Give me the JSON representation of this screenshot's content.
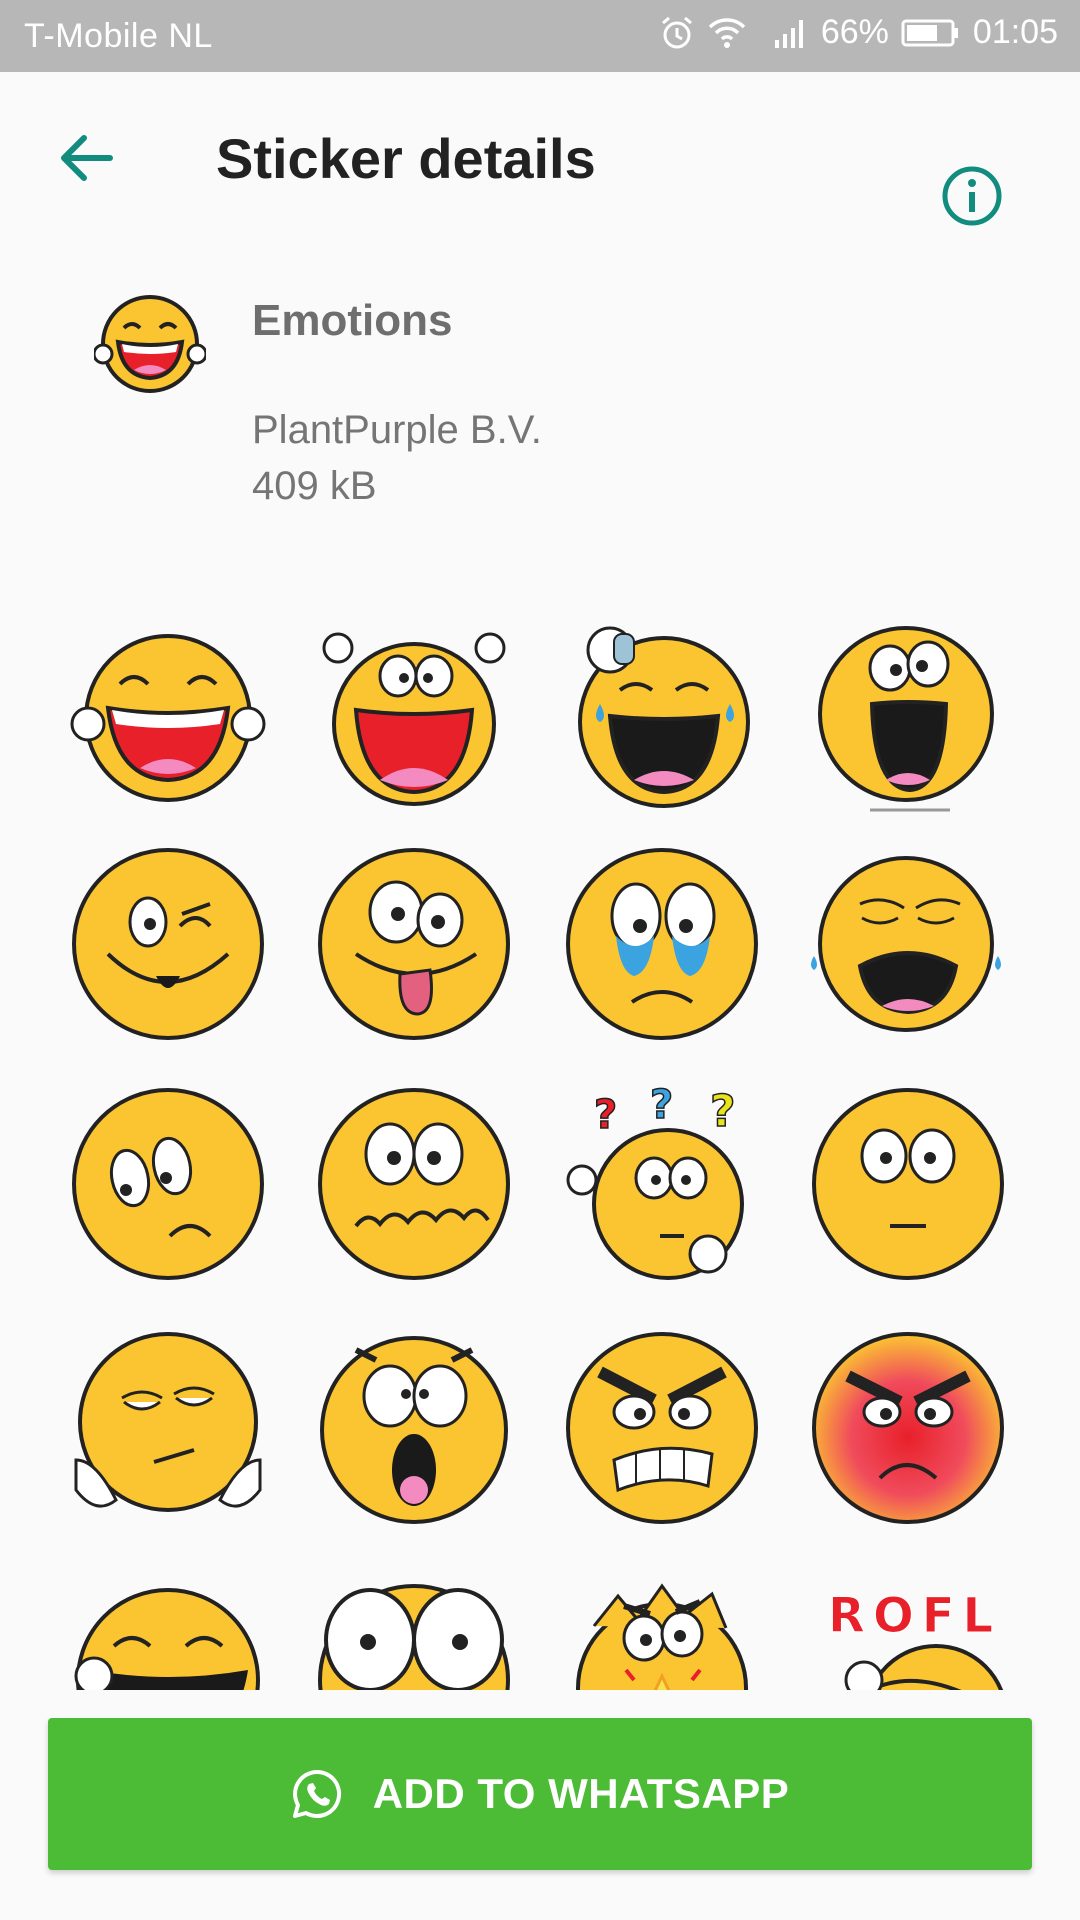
{
  "status_bar": {
    "carrier": "T-Mobile  NL",
    "battery_percent": "66%",
    "time": "01:05",
    "icons": [
      "alarm-icon",
      "wifi-icon",
      "signal-icon",
      "battery-icon"
    ]
  },
  "app_bar": {
    "back_icon": "arrow-left-icon",
    "title": "Sticker details",
    "info_icon": "info-icon",
    "accent_color": "#128c7e"
  },
  "pack": {
    "icon": "laughing-face-sticker",
    "name": "Emotions",
    "publisher": "PlantPurple B.V.",
    "size": "409 kB"
  },
  "stickers": [
    {
      "name": "laughing-hands"
    },
    {
      "name": "big-grin-waving"
    },
    {
      "name": "laughing-tears"
    },
    {
      "name": "shouting-shaking"
    },
    {
      "name": "winking"
    },
    {
      "name": "tongue-out"
    },
    {
      "name": "crying"
    },
    {
      "name": "bawling"
    },
    {
      "name": "sad-tired"
    },
    {
      "name": "nervous-wobbly"
    },
    {
      "name": "confused-question-marks"
    },
    {
      "name": "neutral"
    },
    {
      "name": "bored-chin-in-hands"
    },
    {
      "name": "surprised-shocked"
    },
    {
      "name": "angry-teeth"
    },
    {
      "name": "furious-red"
    },
    {
      "name": "laughing-hidden"
    },
    {
      "name": "wide-eyed"
    },
    {
      "name": "exploding-head"
    },
    {
      "name": "rofl"
    }
  ],
  "rofl_text": "ROFL",
  "question_marks": [
    "?",
    "?",
    "?"
  ],
  "colors": {
    "sticker_yellow": "#fbc531",
    "button_green": "#4cbb35",
    "status_bar_gray": "#b7b7b7"
  },
  "button": {
    "icon": "whatsapp-icon",
    "label": "ADD TO WHATSAPP"
  }
}
